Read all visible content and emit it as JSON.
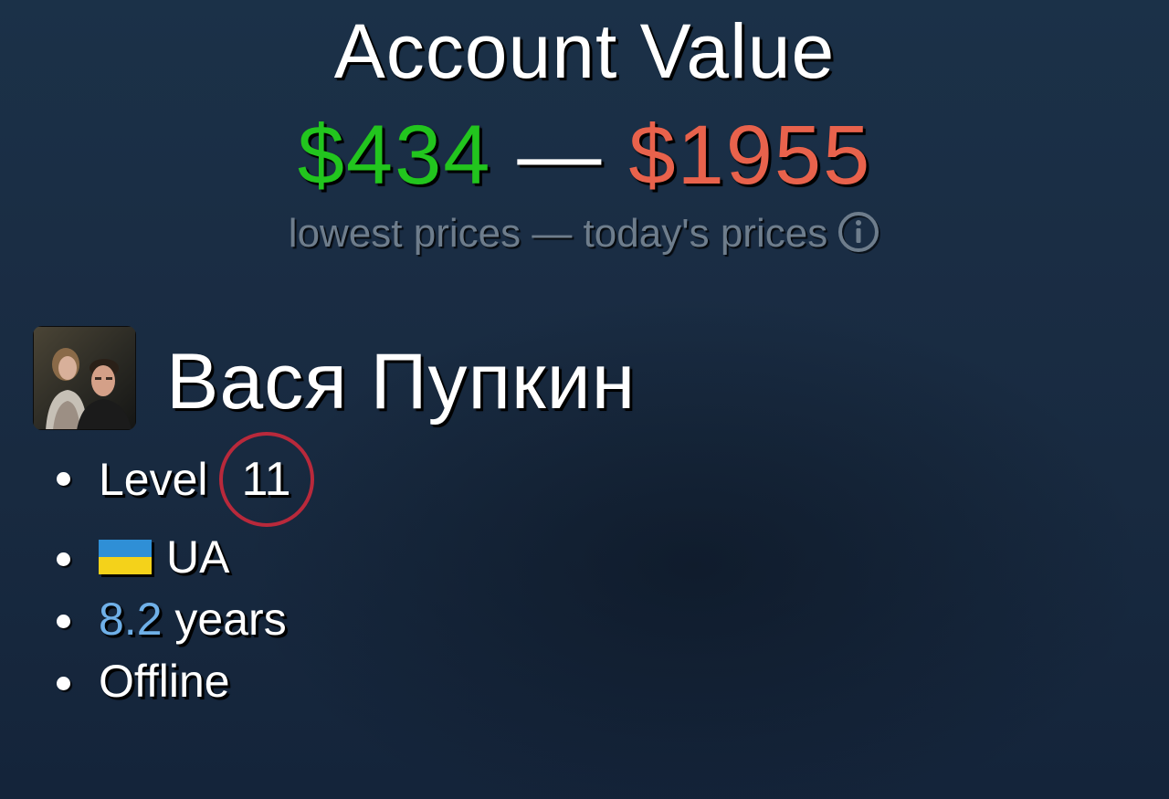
{
  "header": {
    "title": "Account Value",
    "price_low": "$434",
    "price_separator": "—",
    "price_high": "$1955",
    "caption": "lowest prices — today's prices",
    "info_icon": "info-circle-icon"
  },
  "profile": {
    "avatar": "profile-avatar",
    "name": "Вася Пупкин",
    "level_label": "Level",
    "level_value": "11",
    "country_code": "UA",
    "country_flag_colors": [
      "#2f8fd6",
      "#f4d21a"
    ],
    "years_value": "8.2",
    "years_label": "years",
    "status": "Offline"
  },
  "colors": {
    "price_low": "#22c51e",
    "price_high": "#e8624c",
    "level_ring": "#b9293b",
    "years_value": "#6fb0e8",
    "caption": "#6e7d8c"
  }
}
